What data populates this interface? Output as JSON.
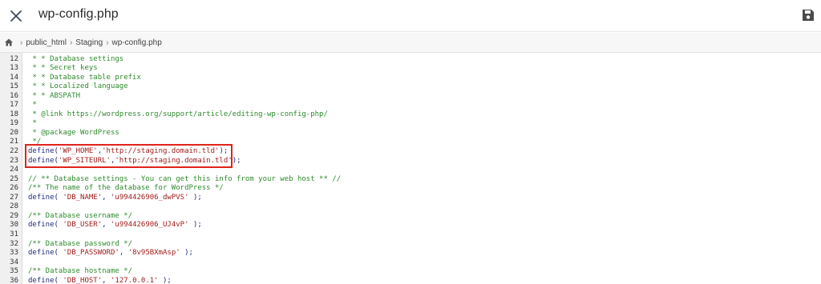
{
  "window": {
    "title": "wp-config.php"
  },
  "icons": {
    "close": "close-icon",
    "save": "save-icon",
    "home": "home-icon"
  },
  "breadcrumb": [
    "public_html",
    "Staging",
    "wp-config.php"
  ],
  "editor": {
    "lines": [
      {
        "n": "12",
        "segs": [
          {
            "t": " * * Database settings",
            "c": "comment"
          }
        ]
      },
      {
        "n": "13",
        "segs": [
          {
            "t": " * * Secret keys",
            "c": "comment"
          }
        ]
      },
      {
        "n": "14",
        "segs": [
          {
            "t": " * * Database table prefix",
            "c": "comment"
          }
        ]
      },
      {
        "n": "15",
        "segs": [
          {
            "t": " * * Localized language",
            "c": "comment"
          }
        ]
      },
      {
        "n": "16",
        "segs": [
          {
            "t": " * * ABSPATH",
            "c": "comment"
          }
        ]
      },
      {
        "n": "17",
        "segs": [
          {
            "t": " *",
            "c": "comment"
          }
        ]
      },
      {
        "n": "18",
        "segs": [
          {
            "t": " * @link https://wordpress.org/support/article/editing-wp-config-php/",
            "c": "comment"
          }
        ]
      },
      {
        "n": "19",
        "segs": [
          {
            "t": " *",
            "c": "comment"
          }
        ]
      },
      {
        "n": "20",
        "segs": [
          {
            "t": " * @package WordPress",
            "c": "comment"
          }
        ]
      },
      {
        "n": "21",
        "segs": [
          {
            "t": " */",
            "c": "comment"
          }
        ]
      },
      {
        "n": "22",
        "segs": [
          {
            "t": "define(",
            "c": "plain"
          },
          {
            "t": "'WP_HOME'",
            "c": "str"
          },
          {
            "t": ",",
            "c": "plain"
          },
          {
            "t": "'http://staging.domain.tld'",
            "c": "str"
          },
          {
            "t": ");",
            "c": "plain"
          }
        ]
      },
      {
        "n": "23",
        "segs": [
          {
            "t": "define(",
            "c": "plain"
          },
          {
            "t": "'WP_SITEURL'",
            "c": "str"
          },
          {
            "t": ",",
            "c": "plain"
          },
          {
            "t": "'http://staging.domain.tld'",
            "c": "str"
          },
          {
            "t": ");",
            "c": "plain"
          }
        ]
      },
      {
        "n": "24",
        "segs": []
      },
      {
        "n": "25",
        "segs": [
          {
            "t": "// ** Database settings - You can get this info from your web host ** //",
            "c": "comment"
          }
        ]
      },
      {
        "n": "26",
        "segs": [
          {
            "t": "/** The name of the database for WordPress */",
            "c": "comment"
          }
        ]
      },
      {
        "n": "27",
        "segs": [
          {
            "t": "define( ",
            "c": "plain"
          },
          {
            "t": "'DB_NAME'",
            "c": "str"
          },
          {
            "t": ", ",
            "c": "plain"
          },
          {
            "t": "'u994426906_dwPVS'",
            "c": "str"
          },
          {
            "t": " );",
            "c": "plain"
          }
        ]
      },
      {
        "n": "28",
        "segs": []
      },
      {
        "n": "29",
        "segs": [
          {
            "t": "/** Database username */",
            "c": "comment"
          }
        ]
      },
      {
        "n": "30",
        "segs": [
          {
            "t": "define( ",
            "c": "plain"
          },
          {
            "t": "'DB_USER'",
            "c": "str"
          },
          {
            "t": ", ",
            "c": "plain"
          },
          {
            "t": "'u994426906_UJ4vP'",
            "c": "str"
          },
          {
            "t": " );",
            "c": "plain"
          }
        ]
      },
      {
        "n": "31",
        "segs": []
      },
      {
        "n": "32",
        "segs": [
          {
            "t": "/** Database password */",
            "c": "comment"
          }
        ]
      },
      {
        "n": "33",
        "segs": [
          {
            "t": "define( ",
            "c": "plain"
          },
          {
            "t": "'DB_PASSWORD'",
            "c": "str"
          },
          {
            "t": ", ",
            "c": "plain"
          },
          {
            "t": "'8v95BXmAsp'",
            "c": "str"
          },
          {
            "t": " );",
            "c": "plain"
          }
        ]
      },
      {
        "n": "34",
        "segs": []
      },
      {
        "n": "35",
        "segs": [
          {
            "t": "/** Database hostname */",
            "c": "comment"
          }
        ]
      },
      {
        "n": "36",
        "segs": [
          {
            "t": "define( ",
            "c": "plain"
          },
          {
            "t": "'DB_HOST'",
            "c": "str"
          },
          {
            "t": ", ",
            "c": "plain"
          },
          {
            "t": "'127.0.0.1'",
            "c": "str"
          },
          {
            "t": " );",
            "c": "plain"
          }
        ]
      }
    ]
  },
  "colors": {
    "highlight_border": "#e0231b",
    "comment": "#2f8a2f",
    "string": "#a01c1c",
    "keyword": "#1f2a7a"
  }
}
